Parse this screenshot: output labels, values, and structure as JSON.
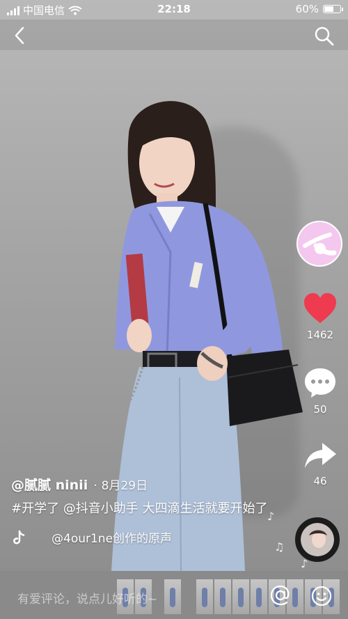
{
  "status_bar": {
    "carrier": "中国电信",
    "time": "22:18",
    "battery": "60%",
    "battery_level": 0.6
  },
  "nav": {
    "back_icon": "chevron-left-icon",
    "search_icon": "search-icon"
  },
  "rail": {
    "like_count": "1462",
    "comment_count": "50",
    "share_count": "46",
    "like_color": "#ee3b4f"
  },
  "post": {
    "author": "@腻腻 ninii",
    "date_separator": "·",
    "date": "8月29日",
    "description": "#开学了 @抖音小助手 大四滴生活就要开始了",
    "music": "@4our1ne创作的原声"
  },
  "comment_bar": {
    "placeholder": "有爱评论，说点儿好听的~",
    "at_icon": "at-icon",
    "emoji_icon": "emoji-icon"
  }
}
